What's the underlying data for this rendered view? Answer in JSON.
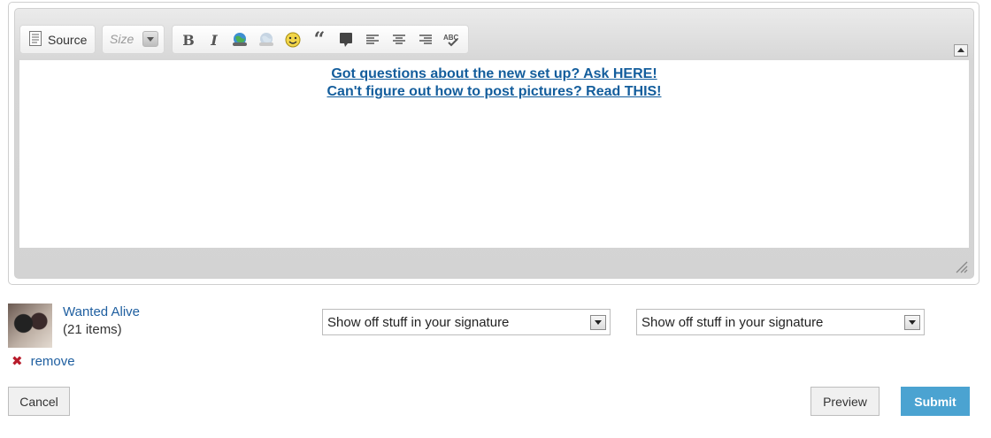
{
  "editor": {
    "toolbar": {
      "source_label": "Source",
      "size_placeholder": "Size",
      "format_icons": [
        "bold-icon",
        "italic-icon",
        "insert-link-icon",
        "insert-image-icon",
        "smiley-icon",
        "blockquote-icon",
        "speech-bubble-icon",
        "align-left-icon",
        "align-center-icon",
        "align-right-icon",
        "spellcheck-icon"
      ]
    },
    "content": {
      "line1": "Got questions about the new set up? Ask HERE!",
      "line2": "Can't figure out how to post pictures? Read THIS!"
    },
    "link_color": "#135d9c"
  },
  "attachment": {
    "name": "Wanted Alive",
    "count": "(21 items)",
    "remove_label": "remove"
  },
  "selects": [
    {
      "value": "Show off stuff in your signature"
    },
    {
      "value": "Show off stuff in your signature"
    }
  ],
  "buttons": {
    "cancel": "Cancel",
    "preview": "Preview",
    "submit": "Submit"
  },
  "colors": {
    "submit_bg": "#4ba3d1",
    "remove_icon": "#b81c2b"
  }
}
